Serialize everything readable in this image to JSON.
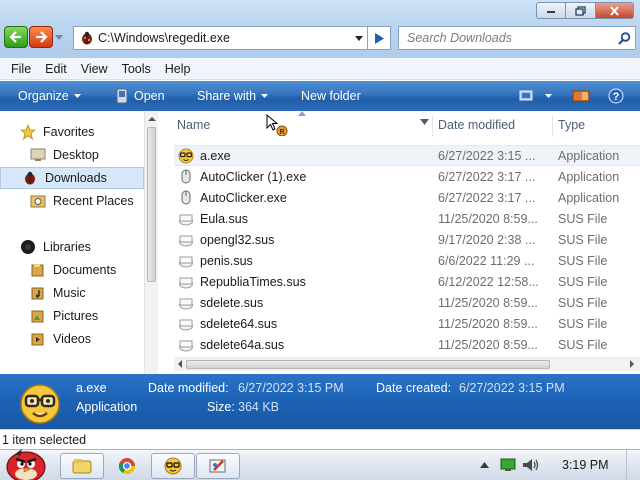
{
  "window": {
    "minimize_icon": "minimize-icon",
    "maximize_icon": "restore-icon",
    "close_icon": "close-icon"
  },
  "address_bar": {
    "path": "C:\\Windows\\regedit.exe",
    "icon": "regedit-ladybug-icon"
  },
  "search": {
    "placeholder": "Search Downloads"
  },
  "menu": {
    "items": [
      {
        "label": "File"
      },
      {
        "label": "Edit"
      },
      {
        "label": "View"
      },
      {
        "label": "Tools"
      },
      {
        "label": "Help"
      }
    ]
  },
  "commands": {
    "organize": "Organize",
    "open": "Open",
    "share": "Share with",
    "new_folder": "New folder"
  },
  "nav": {
    "favorites": {
      "label": "Favorites",
      "items": [
        {
          "label": "Desktop"
        },
        {
          "label": "Downloads",
          "selected": true
        },
        {
          "label": "Recent Places"
        }
      ]
    },
    "libraries": {
      "label": "Libraries",
      "items": [
        {
          "label": "Documents"
        },
        {
          "label": "Music"
        },
        {
          "label": "Pictures"
        },
        {
          "label": "Videos"
        }
      ]
    }
  },
  "file_list": {
    "columns": {
      "name": "Name",
      "date": "Date modified",
      "type": "Type"
    },
    "rows": [
      {
        "name": "a.exe",
        "date": "6/27/2022 3:15 ...",
        "type": "Application",
        "icon": "nerd-face-icon",
        "selected": true
      },
      {
        "name": "AutoClicker (1).exe",
        "date": "6/27/2022 3:17 ...",
        "type": "Application",
        "icon": "mouse-icon"
      },
      {
        "name": "AutoClicker.exe",
        "date": "6/27/2022 3:17 ...",
        "type": "Application",
        "icon": "mouse-icon"
      },
      {
        "name": "Eula.sus",
        "date": "11/25/2020 8:59...",
        "type": "SUS File",
        "icon": "generic-file-icon"
      },
      {
        "name": "opengl32.sus",
        "date": "9/17/2020 2:38 ...",
        "type": "SUS File",
        "icon": "generic-file-icon"
      },
      {
        "name": "penis.sus",
        "date": "6/6/2022 11:29 ...",
        "type": "SUS File",
        "icon": "generic-file-icon"
      },
      {
        "name": "RepubliaTimes.sus",
        "date": "6/12/2022 12:58...",
        "type": "SUS File",
        "icon": "generic-file-icon"
      },
      {
        "name": "sdelete.sus",
        "date": "11/25/2020 8:59...",
        "type": "SUS File",
        "icon": "generic-file-icon"
      },
      {
        "name": "sdelete64.sus",
        "date": "11/25/2020 8:59...",
        "type": "SUS File",
        "icon": "generic-file-icon"
      },
      {
        "name": "sdelete64a.sus",
        "date": "11/25/2020 8:59...",
        "type": "SUS File",
        "icon": "generic-file-icon"
      }
    ]
  },
  "details": {
    "name": "a.exe",
    "type": "Application",
    "modified_label": "Date modified:",
    "modified_value": "6/27/2022 3:15 PM",
    "created_label": "Date created:",
    "created_value": "6/27/2022 3:15 PM",
    "size_label": "Size:",
    "size_value": "364 KB"
  },
  "status": {
    "text": "1 item selected"
  },
  "taskbar": {
    "start_icon": "angry-bird-start-icon",
    "apps": [
      {
        "icon": "explorer-folder-icon"
      },
      {
        "icon": "chrome-icon"
      },
      {
        "icon": "nerd-face-icon",
        "active": true
      },
      {
        "icon": "paint-icon"
      }
    ],
    "clock": "3:19 PM"
  },
  "colors": {
    "command_bar": "#2d6cb7",
    "details_pane": "#1c62b4",
    "selection": "#d6e7f9"
  }
}
